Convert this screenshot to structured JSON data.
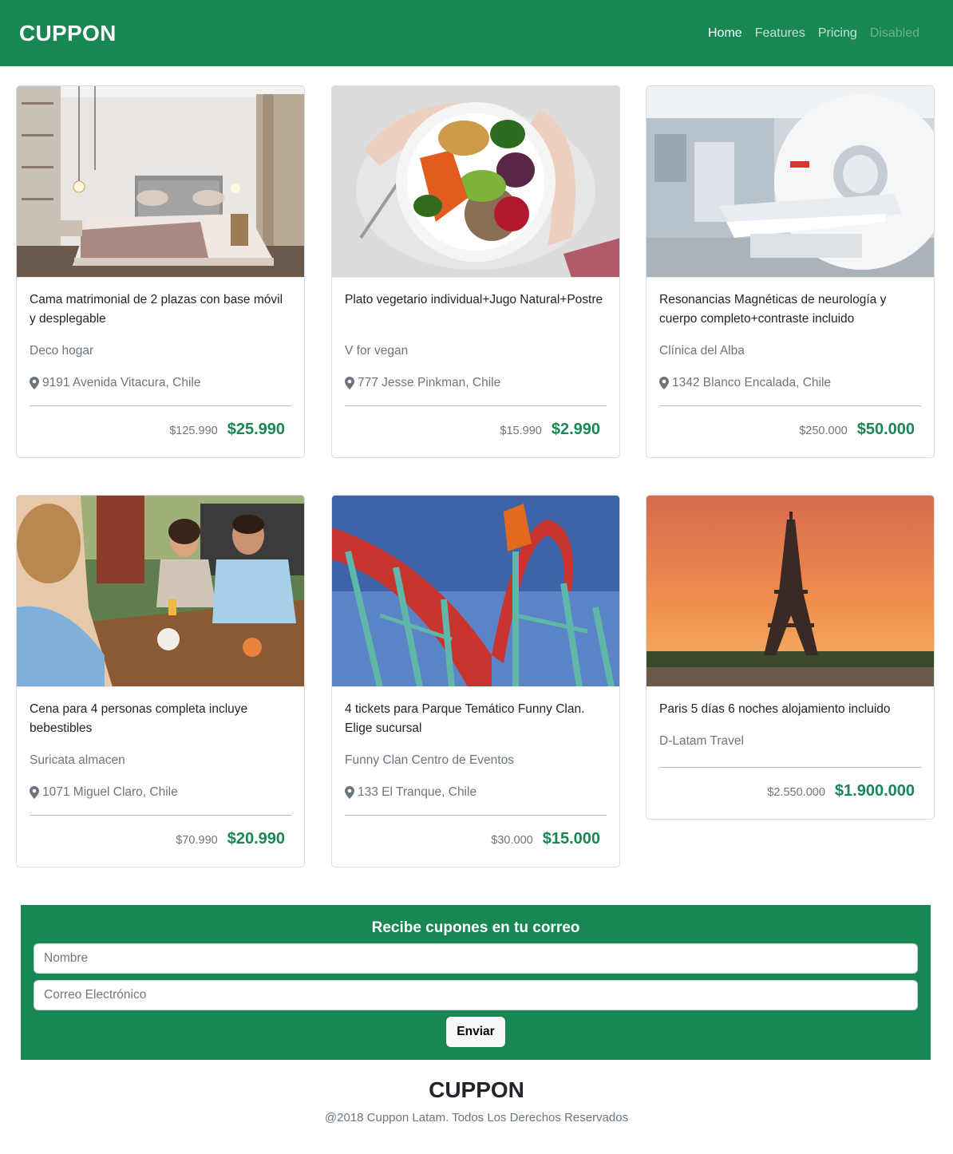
{
  "navbar": {
    "brand": "CUPPON",
    "links": [
      {
        "label": "Home"
      },
      {
        "label": "Features"
      },
      {
        "label": "Pricing"
      },
      {
        "label": "Disabled"
      }
    ]
  },
  "cards": [
    {
      "title": "Cama matrimonial de 2 plazas con base móvil y desplegable",
      "merchant": "Deco hogar",
      "address": "9191 Avenida Vitacura, Chile",
      "old_price": "$125.990",
      "price": "$25.990",
      "image": "bedroom-photo"
    },
    {
      "title": "Plato vegetario individual+Jugo Natural+Postre",
      "merchant": "V for vegan",
      "address": "777 Jesse Pinkman, Chile",
      "old_price": "$15.990",
      "price": "$2.990",
      "image": "vegan-bowl-photo"
    },
    {
      "title": "Resonancias Magnéticas de neurología y cuerpo completo+contraste incluido",
      "merchant": "Clínica del Alba",
      "address": "1342 Blanco Encalada, Chile",
      "old_price": "$250.000",
      "price": "$50.000",
      "image": "mri-scanner-photo"
    },
    {
      "title": "Cena para 4 personas completa incluye bebestibles",
      "merchant": "Suricata almacen",
      "address": "1071 Miguel Claro, Chile",
      "old_price": "$70.990",
      "price": "$20.990",
      "image": "friends-dinner-photo"
    },
    {
      "title": "4 tickets para Parque Temático Funny Clan. Elige sucursal",
      "merchant": "Funny Clan Centro de Eventos",
      "address": "133 El Tranque, Chile",
      "old_price": "$30.000",
      "price": "$15.000",
      "image": "rollercoaster-photo"
    },
    {
      "title": "Paris 5 días 6 noches alojamiento incluido",
      "merchant": "D-Latam Travel",
      "old_price": "$2.550.000",
      "price": "$1.900.000",
      "image": "eiffel-tower-photo"
    }
  ],
  "newsletter": {
    "title": "Recibe cupones en tu correo",
    "name_placeholder": "Nombre",
    "email_placeholder": "Correo Electrónico",
    "submit_label": "Enviar"
  },
  "footer": {
    "brand": "CUPPON",
    "copyright": "@2018 Cuppon Latam. Todos Los Derechos Reservados"
  },
  "colors": {
    "primary": "#198754",
    "muted": "#6c757d"
  }
}
